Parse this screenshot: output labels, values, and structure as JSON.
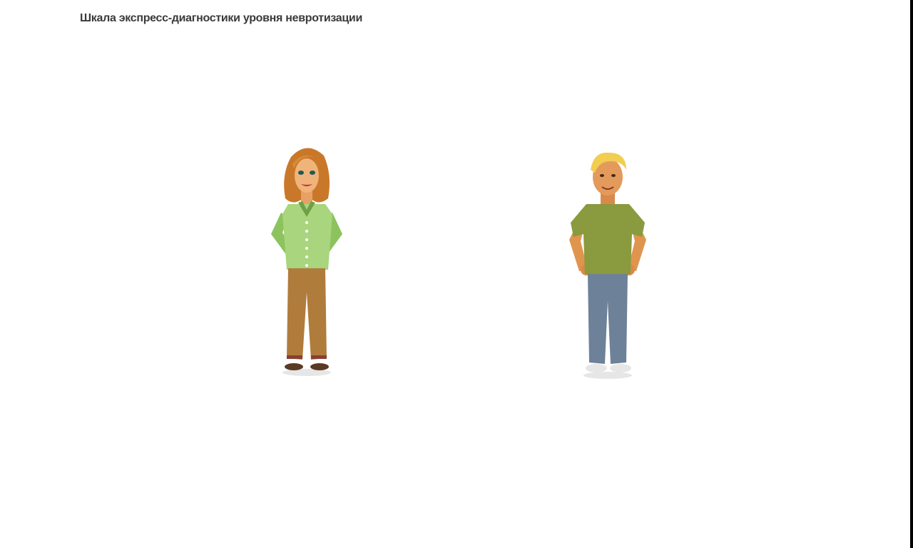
{
  "header": {
    "title": "Шкала экспресс-диагностики уровня невротизации"
  },
  "characters": [
    {
      "id": "woman",
      "icon": "woman-character-icon"
    },
    {
      "id": "man",
      "icon": "man-character-icon"
    }
  ],
  "colors": {
    "background": "#ffffff",
    "title_text": "#3a3a3a",
    "edge_bar": "#000000",
    "woman_blouse": "#9bce6e",
    "woman_pants": "#b07c3c",
    "man_shirt": "#8a9a3e",
    "man_jeans": "#6d8299"
  }
}
